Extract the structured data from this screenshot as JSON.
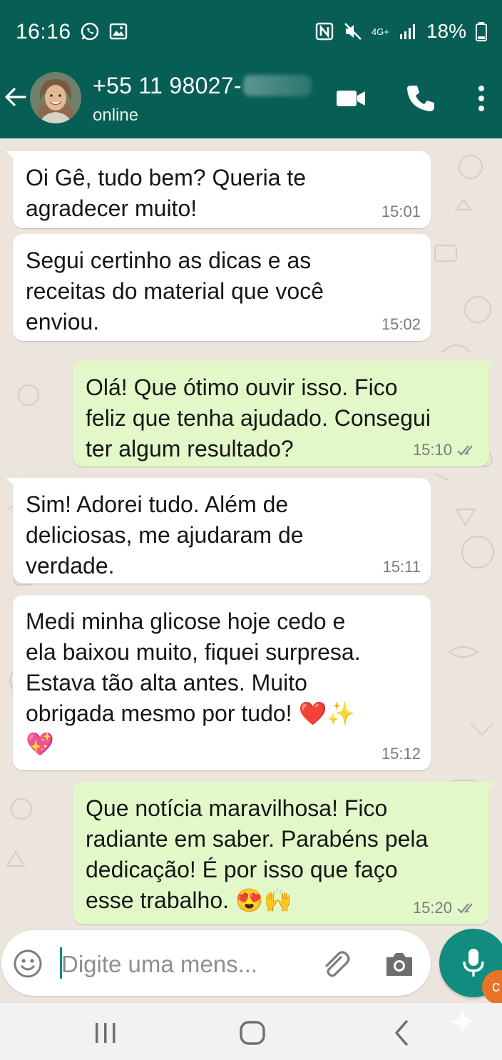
{
  "status_bar": {
    "time": "16:16",
    "network": "4G+",
    "battery": "18%",
    "left_icons": [
      "whatsapp-icon",
      "gallery-icon"
    ],
    "right_icons": [
      "nfc-icon",
      "mute-icon",
      "signal-icon",
      "battery-icon"
    ]
  },
  "header": {
    "contact_name": "+55 11 98027-",
    "status": "online",
    "icons": [
      "back-arrow-icon",
      "video-call-icon",
      "phone-call-icon",
      "more-options-icon"
    ]
  },
  "messages": [
    {
      "direction": "in",
      "text": "Oi Gê, tudo bem? Queria te\nagradecer muito!",
      "time": "15:01"
    },
    {
      "direction": "in",
      "text": "Segui certinho as dicas e as\nreceitas do material que você\nenviou.",
      "time": "15:02"
    },
    {
      "direction": "out",
      "text": "Olá! Que ótimo ouvir isso. Fico\nfeliz que tenha ajudado. Consegui\nter algum resultado?",
      "time": "15:10",
      "read": true
    },
    {
      "direction": "in",
      "text": "Sim! Adorei tudo. Além de\ndeliciosas, me ajudaram de\nverdade.",
      "time": "15:11"
    },
    {
      "direction": "in",
      "text": "Medi minha glicose hoje cedo e\nela baixou muito, fiquei surpresa.\nEstava tão alta antes. Muito\nobrigada mesmo por tudo! ❤️✨\n💖",
      "time": "15:12"
    },
    {
      "direction": "out",
      "text": "Que notícia maravilhosa! Fico\nradiante em saber. Parabéns pela\ndedicação! É por isso que faço\nesse trabalho. 😍🙌",
      "time": "15:20",
      "read": true
    }
  ],
  "input_bar": {
    "placeholder": "Digite uma mens...",
    "icons": [
      "emoji-icon",
      "attach-icon",
      "camera-icon",
      "mic-icon"
    ]
  },
  "colors": {
    "header_bg": "#075e54",
    "chat_bg": "#ece5dd",
    "incoming_bubble": "#ffffff",
    "outgoing_bubble": "#e2f8c9",
    "accent": "#128c7e",
    "read_ticks": "#8a8a8a"
  }
}
